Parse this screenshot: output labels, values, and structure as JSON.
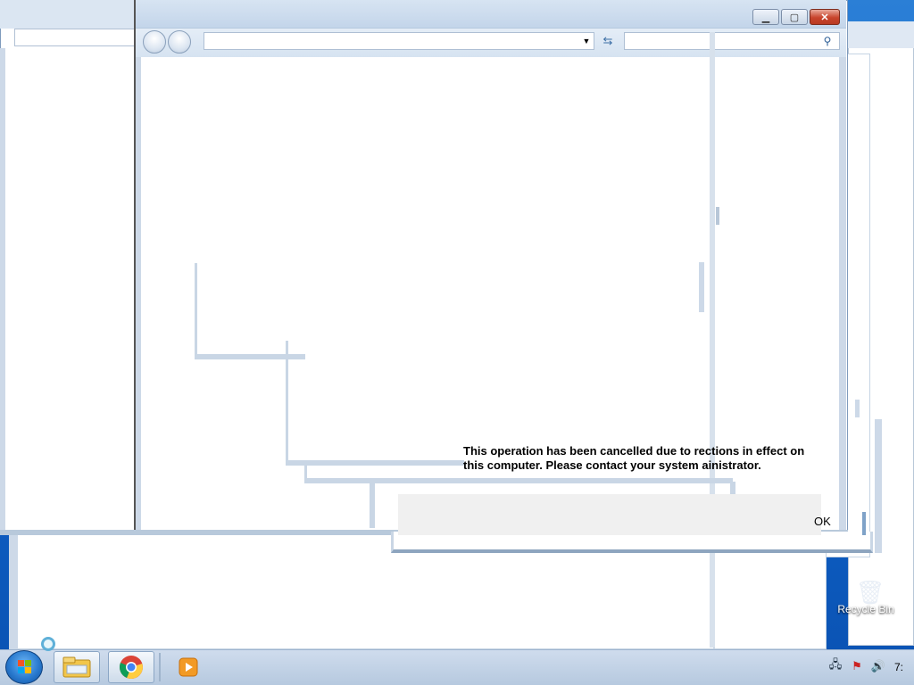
{
  "window": {
    "minimize_icon": "minimize-icon",
    "maximize_icon": "maximize-icon",
    "close_icon": "close-icon",
    "back_icon": "back-arrow-icon",
    "forward_icon": "forward-arrow-icon",
    "dropdown_icon": "chevron-down-icon",
    "refresh_icon": "refresh-icon",
    "search_icon": "search-icon",
    "address_value": "",
    "search_value": ""
  },
  "dialog": {
    "message_line1": "This operation has been cancelled due to re",
    "message_line1_b": "ctions in effect on",
    "message_line2": "this computer. Please contact your system a",
    "message_line2_b": "inistrator.",
    "ok_label": "OK"
  },
  "desktop": {
    "recycle_bin_label": "Recycle Bin",
    "recycle_bin_icon": "recycle-bin-icon"
  },
  "taskbar": {
    "start_icon": "windows-start-icon",
    "pinned": [
      {
        "name": "file-explorer-icon"
      },
      {
        "name": "chrome-icon"
      },
      {
        "name": "media-player-icon"
      }
    ],
    "tray": [
      {
        "name": "network-icon"
      },
      {
        "name": "action-center-icon"
      },
      {
        "name": "volume-icon"
      }
    ],
    "clock": "7:"
  }
}
